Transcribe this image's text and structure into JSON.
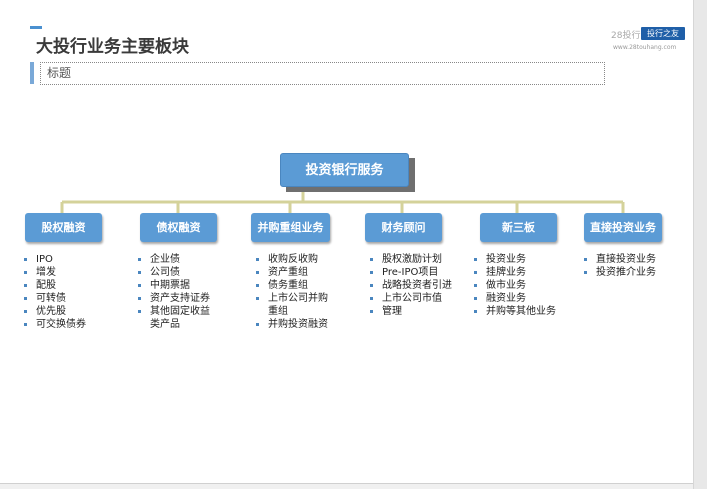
{
  "slide": {
    "title": "大投行业务主要板块",
    "subtitle_placeholder": "标题",
    "brand": {
      "name": "28投行",
      "tag": "投行之友",
      "url": "www.28touhang.com"
    }
  },
  "org_chart": {
    "root": "投资银行服务",
    "categories": [
      {
        "label": "股权融资",
        "items": [
          "IPO",
          "增发",
          "配股",
          "可转债",
          "优先股",
          "可交换债券"
        ]
      },
      {
        "label": "债权融资",
        "items": [
          "企业债",
          "公司债",
          "中期票据",
          "资产支持证券",
          "其他固定收益",
          "类产品"
        ]
      },
      {
        "label": "并购重组业务",
        "items": [
          "收购反收购",
          "资产重组",
          "债务重组",
          "上市公司并购",
          "重组",
          "并购投资融资"
        ]
      },
      {
        "label": "财务顾问",
        "items": [
          "股权激励计划",
          "Pre-IPO项目",
          "战略投资者引进",
          "上市公司市值",
          "管理"
        ]
      },
      {
        "label": "新三板",
        "items": [
          "投资业务",
          "挂牌业务",
          "做市业务",
          "融资业务",
          "并购等其他业务"
        ]
      },
      {
        "label": "直接投资业务",
        "items": [
          "直接投资业务",
          "投资推介业务"
        ]
      }
    ]
  },
  "colors": {
    "node_fill": "#5b9bd5",
    "connector": "#d4d29a",
    "title_accent": "#4a90d0",
    "brand_tag": "#1f5fa8"
  }
}
